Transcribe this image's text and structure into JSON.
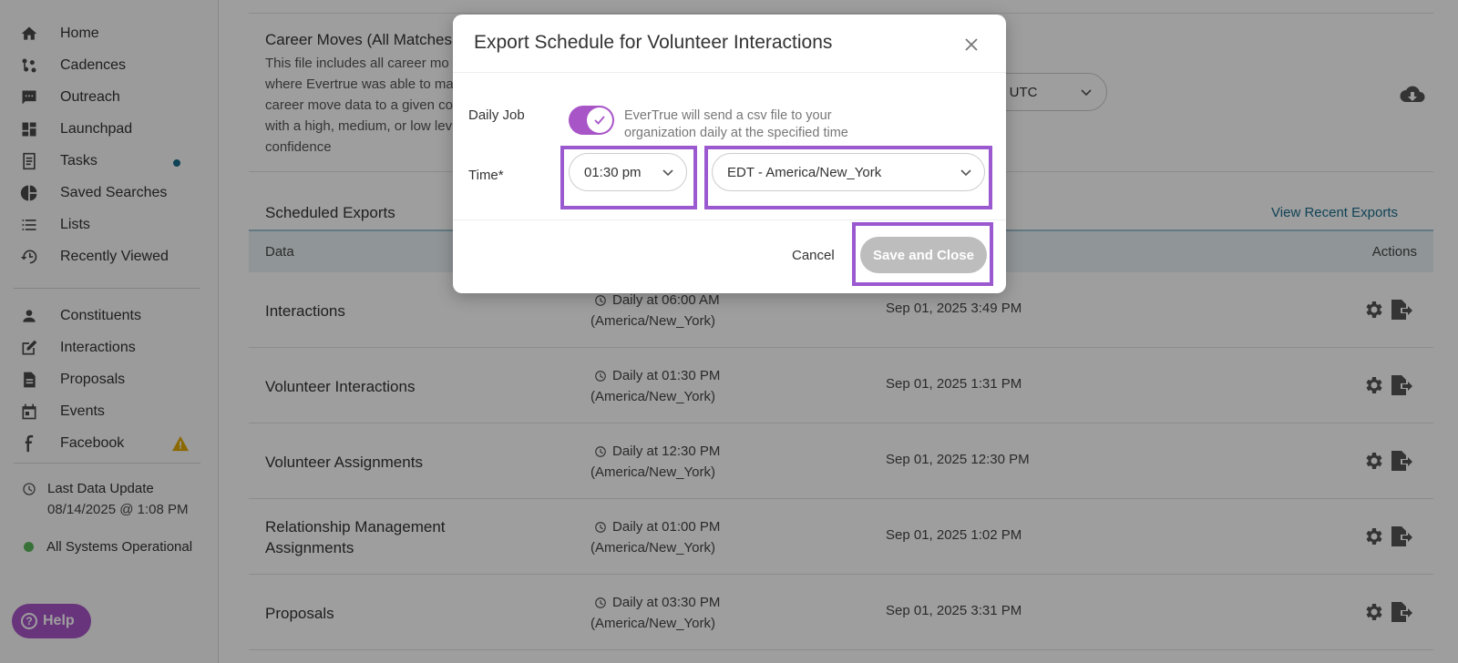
{
  "sidebar": {
    "items": [
      {
        "label": "Home",
        "icon": "home-icon"
      },
      {
        "label": "Cadences",
        "icon": "cadences-icon"
      },
      {
        "label": "Outreach",
        "icon": "chat-icon"
      },
      {
        "label": "Launchpad",
        "icon": "dashboard-icon"
      },
      {
        "label": "Tasks",
        "icon": "tasks-icon"
      },
      {
        "label": "Saved Searches",
        "icon": "pie-chart-icon"
      },
      {
        "label": "Lists",
        "icon": "list-icon"
      },
      {
        "label": "Recently Viewed",
        "icon": "history-icon"
      },
      {
        "label": "Constituents",
        "icon": "person-icon"
      },
      {
        "label": "Interactions",
        "icon": "edit-icon"
      },
      {
        "label": "Proposals",
        "icon": "document-icon"
      },
      {
        "label": "Events",
        "icon": "calendar-icon"
      },
      {
        "label": "Facebook",
        "icon": "facebook-icon"
      }
    ],
    "last_update_label": "Last Data Update",
    "last_update_value": "08/14/2025 @ 1:08 PM",
    "status": "All Systems Operational",
    "help": "Help"
  },
  "career": {
    "title": "Career Moves (All Matches",
    "description": "This file includes all career mo where Evertrue was able to ma career move data to a given co with a high, medium, or low lev confidence",
    "time_select": "M UTC"
  },
  "scheduled": {
    "title": "Scheduled Exports",
    "view_recent": "View Recent Exports",
    "columns": {
      "data": "Data",
      "actions": "Actions"
    },
    "rows": [
      {
        "name": "Interactions",
        "schedule": "Daily at 06:00 AM",
        "tz": "(America/New_York)",
        "last": "Sep 01, 2025 3:49 PM"
      },
      {
        "name": "Volunteer Interactions",
        "schedule": "Daily at 01:30 PM",
        "tz": "(America/New_York)",
        "last": "Sep 01, 2025 1:31 PM"
      },
      {
        "name": "Volunteer Assignments",
        "schedule": "Daily at 12:30 PM",
        "tz": "(America/New_York)",
        "last": "Sep 01, 2025 12:30 PM"
      },
      {
        "name": "Relationship Management Assignments",
        "schedule": "Daily at 01:00 PM",
        "tz": "(America/New_York)",
        "last": "Sep 01, 2025 1:02 PM"
      },
      {
        "name": "Proposals",
        "schedule": "Daily at 03:30 PM",
        "tz": "(America/New_York)",
        "last": "Sep 01, 2025 3:31 PM"
      }
    ]
  },
  "modal": {
    "title": "Export Schedule for Volunteer Interactions",
    "daily_label": "Daily Job",
    "daily_enabled": true,
    "daily_desc": "EverTrue will send a csv file to your organization daily at the specified time",
    "time_label": "Time*",
    "time_value": "01:30 pm",
    "timezone_value": "EDT - America/New_York",
    "cancel": "Cancel",
    "save": "Save and Close"
  },
  "colors": {
    "accent_purple": "#a855c8",
    "highlight": "#9b59d0",
    "link": "#1a6d8c",
    "status_green": "#5cb85c",
    "warning": "#e0a800"
  }
}
